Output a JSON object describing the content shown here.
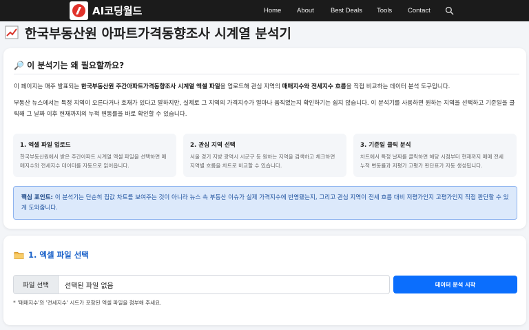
{
  "nav": {
    "brand": "AI코딩월드",
    "menu": [
      "Home",
      "About",
      "Best Deals",
      "Tools",
      "Contact"
    ],
    "search_icon": "search-icon"
  },
  "page": {
    "title": "한국부동산원 아파트가격동향조사 시계열 분석기",
    "title_icon": "chart-up-icon"
  },
  "intro": {
    "heading": "🔎 이 분석기는 왜 필요할까요?",
    "p1_a": "이 페이지는 매주 발표되는 ",
    "p1_b": "한국부동산원 주간아파트가격동향조사 시계열 엑셀 파일",
    "p1_c": "을 업로드해 관심 지역의 ",
    "p1_d": "매매지수와 전세지수 흐름",
    "p1_e": "을 직접 비교하는 데이터 분석 도구입니다.",
    "p2": "부동산 뉴스에서는 특정 지역이 오른다거나 호재가 있다고 말하지만, 실제로 그 지역의 가격지수가 얼마나 움직였는지 확인하기는 쉽지 않습니다. 이 분석기를 사용하면 원하는 지역을 선택하고 기준일을 클릭해 그 날짜 이후 현재까지의 누적 변동률을 바로 확인할 수 있습니다.",
    "steps": [
      {
        "title": "1. 엑셀 파일 업로드",
        "desc": "한국부동산원에서 받은 주간아파트 시계열 엑셀 파일을 선택하면 매매지수와 전세지수 데이터를 자동으로 읽어옵니다."
      },
      {
        "title": "2. 관심 지역 선택",
        "desc": "서울 경기 지방 광역시 시군구 등 원하는 지역을 검색하고 체크하면 지역별 흐름을 차트로 비교할 수 있습니다."
      },
      {
        "title": "3. 기준일 클릭 분석",
        "desc": "차트에서 특정 날짜를 클릭하면 해당 시점부터 현재까지 매매 전세 누적 변동률과 저평가 고평가 판단표가 자동 생성됩니다."
      }
    ],
    "keypoint_label": "핵심 포인트:",
    "keypoint_text": " 이 분석기는 단순히 집값 차트를 보여주는 것이 아니라 뉴스 속 부동산 이슈가 실제 가격지수에 반영됐는지, 그리고 관심 지역이 전세 흐름 대비 저평가인지 고평가인지 직접 판단할 수 있게 도와줍니다."
  },
  "upload": {
    "heading": "1. 엑셀 파일 선택",
    "heading_icon": "folder-icon",
    "file_button": "파일 선택",
    "file_status": "선택된 파일 없음",
    "run_button": "데이터 분석 시작",
    "hint": "* '매매지수'와 '전세지수' 시트가 포함된 엑셀 파일을 첨부해 주세요."
  },
  "colors": {
    "accent": "#0b6efd",
    "heading_blue": "#1b62c9",
    "nav_bg": "#1b1b1b",
    "keypoint_bg": "#dce9fb"
  }
}
